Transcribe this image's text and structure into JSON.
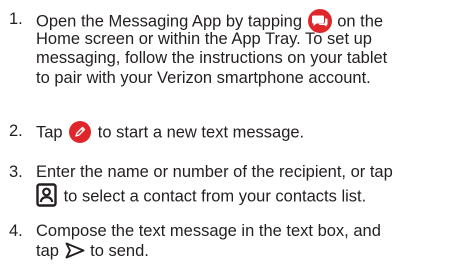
{
  "colors": {
    "text": "#231f20",
    "accent_red": "#e0262b"
  },
  "steps": [
    {
      "number": "1.",
      "before_icon": "Open the Messaging App by tapping",
      "icon": "messaging-app-icon",
      "line1_end": "on the",
      "lines": [
        "Home screen or within the App Tray. To set up",
        "messaging, follow the instructions on your tablet",
        "to pair with your Verizon smartphone account."
      ]
    },
    {
      "number": "2.",
      "before_icon": "Tap",
      "icon": "compose-pencil-icon",
      "after_icon": "to start a new text message."
    },
    {
      "number": "3.",
      "line1": "Enter the name or number of the recipient, or tap",
      "icon": "contact-card-icon",
      "after_icon": "to select a contact from your contacts list."
    },
    {
      "number": "4.",
      "line1": "Compose the text message in the text box, and",
      "before_icon": "tap",
      "icon": "send-arrow-icon",
      "after_icon": "to send."
    }
  ]
}
